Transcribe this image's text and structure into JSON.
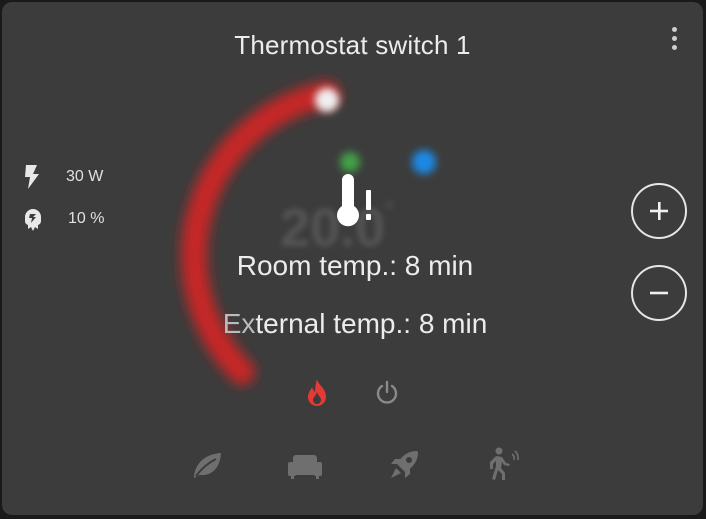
{
  "card": {
    "title": "Thermostat switch 1"
  },
  "info": {
    "power": {
      "icon": "lightning-bolt-icon",
      "value": "30 W"
    },
    "heating_level": {
      "icon": "heating-level-icon",
      "value": "10 %"
    }
  },
  "dial": {
    "target_value": "20.0",
    "unit": "°",
    "arc_color": "#c62828"
  },
  "status": {
    "icon": "thermometer-alert-icon",
    "line1": "Room temp.: 8 min",
    "line2_faded": "Ex",
    "line2_rest": "ternal temp.: 8 min"
  },
  "controls": {
    "increase_label": "+",
    "decrease_label": "−"
  },
  "hvac_modes": [
    {
      "name": "heat",
      "icon": "fire-icon",
      "active": true,
      "color": "#e53935"
    },
    {
      "name": "off",
      "icon": "power-icon",
      "active": false,
      "color": "#8a8a8a"
    }
  ],
  "presets": [
    {
      "name": "eco",
      "icon": "leaf-icon"
    },
    {
      "name": "comfort",
      "icon": "sofa-icon"
    },
    {
      "name": "boost",
      "icon": "rocket-icon"
    },
    {
      "name": "away",
      "icon": "walk-icon"
    }
  ]
}
